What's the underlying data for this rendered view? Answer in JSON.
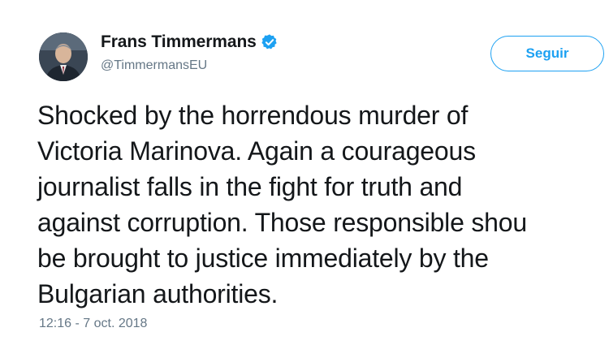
{
  "author": {
    "display_name": "Frans Timmermans",
    "handle": "@TimmermansEU",
    "verified": true,
    "avatar_icon": "user-portrait-avatar"
  },
  "follow_button": {
    "label": "Seguir"
  },
  "tweet": {
    "lines": [
      "Shocked by the horrendous murder of",
      "Victoria Marinova. Again a courageous",
      "journalist falls in the fight for truth and",
      "against corruption. Those responsible shou",
      "be brought to justice immediately by the",
      "Bulgarian authorities."
    ],
    "timestamp": "12:16 - 7 oct. 2018"
  },
  "colors": {
    "accent": "#1da1f2",
    "text": "#14171a",
    "secondary_text": "#657786",
    "background": "#ffffff"
  }
}
